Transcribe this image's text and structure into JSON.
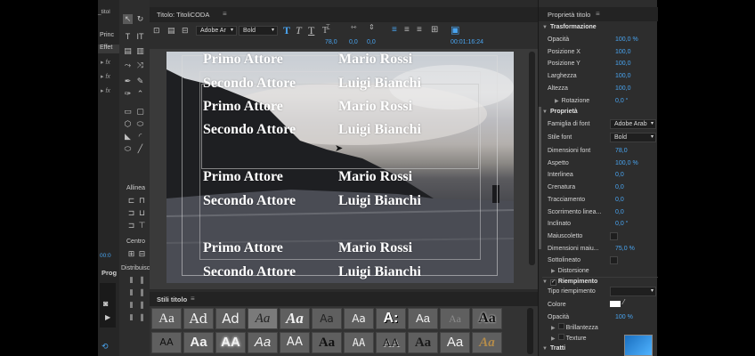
{
  "left_tabs": {
    "top_label": "_titol",
    "panel_a": "Princ",
    "panel_b": "Effet",
    "panel_c": "Prog"
  },
  "tools_panel": {
    "align_label": "Allinea",
    "center_label": "Centro",
    "distribute_label": "Distribuisci",
    "timecode_small": "00:0"
  },
  "title_panel": {
    "title": "Titolo: TitoliCODA",
    "font_value": "Adobe Ar",
    "style_value": "Bold",
    "font_size": "78,0",
    "kerning": "0,0",
    "leading": "0,0",
    "timecode": "00:01:16:24"
  },
  "credits": [
    {
      "role": "Primo Attore",
      "name": "Mario Rossi"
    },
    {
      "role": "Secondo Attore",
      "name": "Luigi Bianchi"
    },
    {
      "role": "Primo Attore",
      "name": "Mario Rossi"
    },
    {
      "role": "Secondo Attore",
      "name": "Luigi Bianchi"
    },
    {
      "role": "Primo Attore",
      "name": "Mario Rossi"
    },
    {
      "role": "Secondo Attore",
      "name": "Luigi Bianchi"
    },
    {
      "role": "Primo Attore",
      "name": "Mario Rossi"
    },
    {
      "role": "Secondo Attore",
      "name": "Luigi Bianchi"
    }
  ],
  "styles_panel": {
    "title": "Stili titolo",
    "row1": [
      "Aa",
      "Ad",
      "Ad",
      "Aa",
      "Aa",
      "Aa",
      "Aa",
      "A:",
      "Aa",
      "Aa",
      "Aa"
    ],
    "row2": [
      "AA",
      "Aa",
      "AA",
      "Aa",
      "AA",
      "Aa",
      "AA",
      "AA",
      "Aa",
      "Aa",
      "Aa"
    ]
  },
  "properties": {
    "title": "Proprietà titolo",
    "transform_header": "Trasformazione",
    "transform": [
      {
        "label": "Opacità",
        "value": "100,0 %"
      },
      {
        "label": "Posizione X",
        "value": "100,0"
      },
      {
        "label": "Posizione Y",
        "value": "100,0"
      },
      {
        "label": "Larghezza",
        "value": "100,0"
      },
      {
        "label": "Altezza",
        "value": "100,0"
      },
      {
        "label": "Rotazione",
        "value": "0,0 °"
      }
    ],
    "props_header": "Proprietà",
    "font_family_label": "Famiglia di font",
    "font_family_value": "Adobe Arab",
    "font_style_label": "Stile font",
    "font_style_value": "Bold",
    "props": [
      {
        "label": "Dimensioni font",
        "value": "78,0"
      },
      {
        "label": "Aspetto",
        "value": "100,0 %"
      },
      {
        "label": "Interlinea",
        "value": "0,0"
      },
      {
        "label": "Crenatura",
        "value": "0,0"
      },
      {
        "label": "Tracciamento",
        "value": "0,0"
      },
      {
        "label": "Scorrimento linea...",
        "value": "0,0"
      },
      {
        "label": "Inclinato",
        "value": "0,0 °"
      }
    ],
    "maiuscoletto_label": "Maiuscoletto",
    "dim_maiu_label": "Dimensioni maiu...",
    "dim_maiu_value": "75,0 %",
    "sottolineato_label": "Sottolineato",
    "distorsione_label": "Distorsione",
    "fill_header": "Riempimento",
    "fill_type_label": "Tipo riempimento",
    "color_label": "Colore",
    "fill_opacity_label": "Opacità",
    "fill_opacity_value": "100 %",
    "brillantezza_label": "Brillantezza",
    "texture_label": "Texture",
    "tratti_header": "Tratti"
  }
}
